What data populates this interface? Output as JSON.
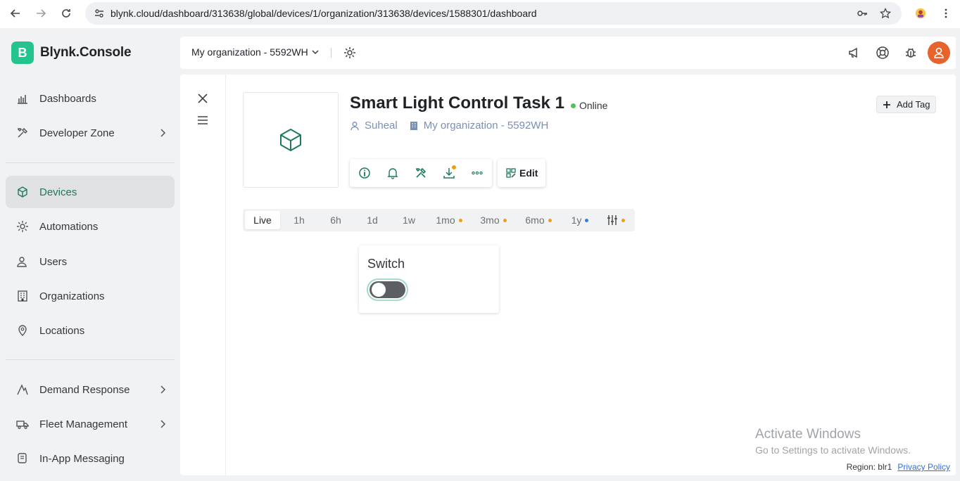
{
  "browser": {
    "url": "blynk.cloud/dashboard/313638/global/devices/1/organization/313638/devices/1588301/dashboard"
  },
  "sidebar": {
    "brand_letter": "B",
    "brand_name": "Blynk.Console",
    "items": [
      {
        "label": "Dashboards",
        "icon": "bar-chart-icon",
        "active": false,
        "expandable": false
      },
      {
        "label": "Developer Zone",
        "icon": "tools-icon",
        "active": false,
        "expandable": true
      },
      {
        "label": "Devices",
        "icon": "cube-icon",
        "active": true,
        "expandable": false
      },
      {
        "label": "Automations",
        "icon": "automation-icon",
        "active": false,
        "expandable": false
      },
      {
        "label": "Users",
        "icon": "users-icon",
        "active": false,
        "expandable": false
      },
      {
        "label": "Organizations",
        "icon": "building-icon",
        "active": false,
        "expandable": false
      },
      {
        "label": "Locations",
        "icon": "location-pin-icon",
        "active": false,
        "expandable": false
      },
      {
        "label": "Demand Response",
        "icon": "demand-icon",
        "active": false,
        "expandable": true
      },
      {
        "label": "Fleet Management",
        "icon": "truck-icon",
        "active": false,
        "expandable": true
      },
      {
        "label": "In-App Messaging",
        "icon": "message-icon",
        "active": false,
        "expandable": false
      }
    ]
  },
  "header": {
    "org_name": "My organization - 5592WH"
  },
  "device": {
    "title": "Smart Light Control Task 1",
    "status": "Online",
    "owner": "Suheal",
    "organization": "My organization - 5592WH",
    "edit_label": "Edit",
    "add_tag_label": "Add Tag"
  },
  "time_tabs": [
    {
      "label": "Live",
      "active": true,
      "dot": ""
    },
    {
      "label": "1h",
      "active": false,
      "dot": ""
    },
    {
      "label": "6h",
      "active": false,
      "dot": ""
    },
    {
      "label": "1d",
      "active": false,
      "dot": ""
    },
    {
      "label": "1w",
      "active": false,
      "dot": ""
    },
    {
      "label": "1mo",
      "active": false,
      "dot": "#f39c12"
    },
    {
      "label": "3mo",
      "active": false,
      "dot": "#f39c12"
    },
    {
      "label": "6mo",
      "active": false,
      "dot": "#f39c12"
    },
    {
      "label": "1y",
      "active": false,
      "dot": "#2e7be6"
    }
  ],
  "widget": {
    "title": "Switch",
    "state": "off"
  },
  "watermark": {
    "line1": "Activate Windows",
    "line2": "Go to Settings to activate Windows."
  },
  "footer": {
    "region": "Region: blr1",
    "privacy": "Privacy Policy"
  },
  "colors": {
    "brand": "#23c48e",
    "online": "#4fc35a",
    "active_text": "#1d7a5a"
  }
}
